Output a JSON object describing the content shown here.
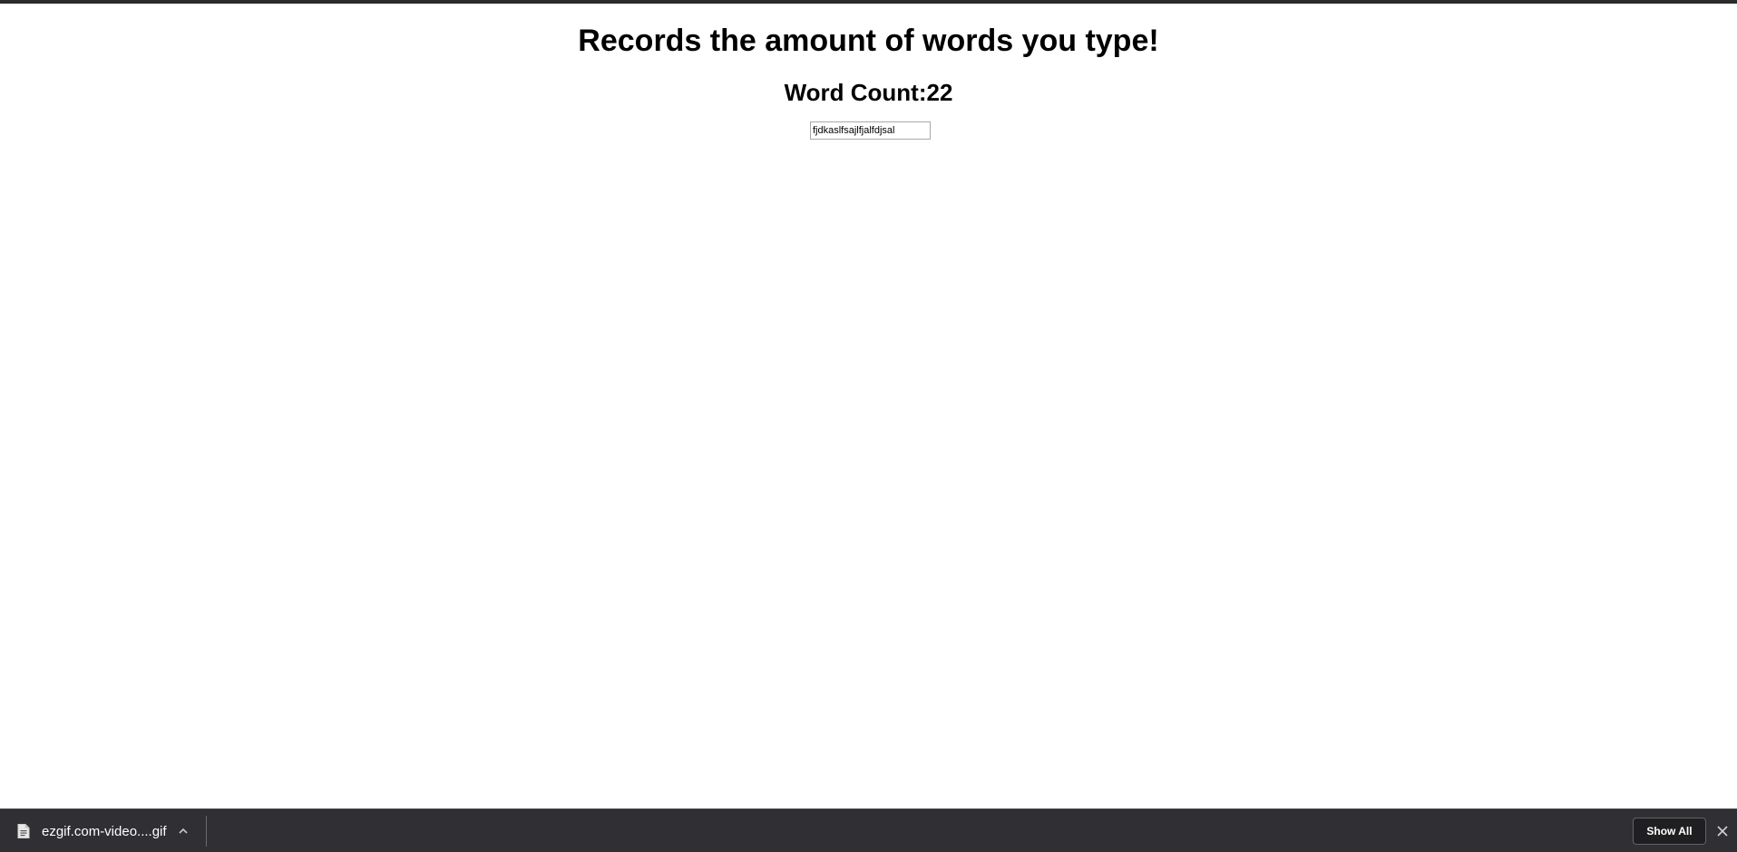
{
  "page": {
    "heading": "Records the amount of words you type!",
    "word_count": "Word Count:22",
    "input_value": "fjdkaslfsajlfjalfdjsal"
  },
  "download_bar": {
    "file_name": "ezgif.com-video....gif",
    "show_all_label": "Show All",
    "icons": {
      "file": "file-icon",
      "expand": "chevron-up-icon",
      "close": "close-icon"
    }
  },
  "colors": {
    "download_bar_bg": "#303034",
    "text_primary": "#000000"
  }
}
